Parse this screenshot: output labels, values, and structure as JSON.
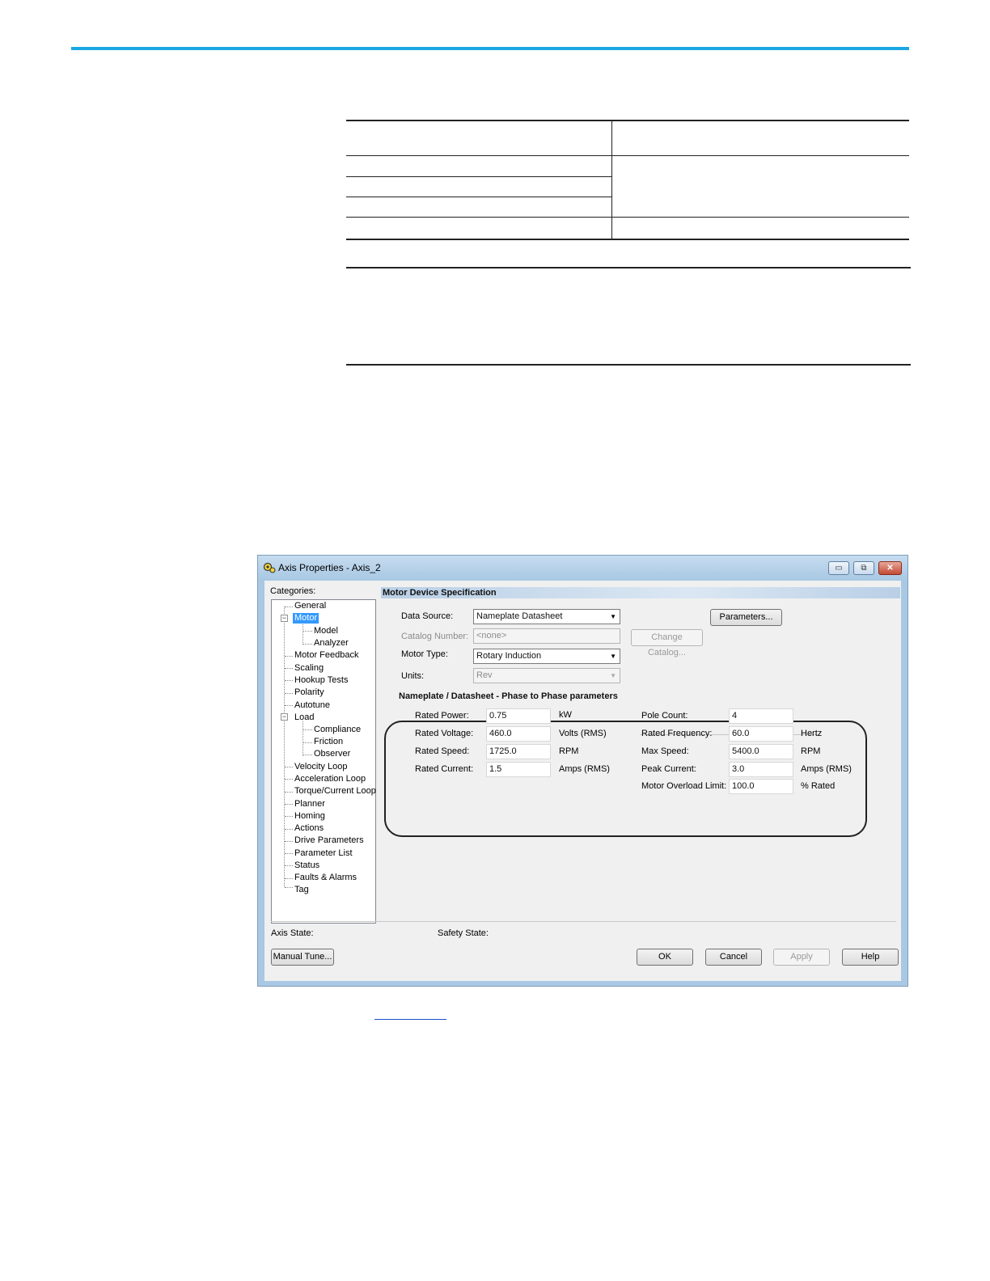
{
  "dialog": {
    "title": "Axis Properties - Axis_2",
    "window_buttons": {
      "minimize": "▭",
      "restore": "⧉",
      "close": "✕"
    },
    "categories_label": "Categories:",
    "tree": [
      "General",
      "Motor",
      "Model",
      "Analyzer",
      "Motor Feedback",
      "Scaling",
      "Hookup Tests",
      "Polarity",
      "Autotune",
      "Load",
      "Compliance",
      "Friction",
      "Observer",
      "Velocity Loop",
      "Acceleration Loop",
      "Torque/Current Loop",
      "Planner",
      "Homing",
      "Actions",
      "Drive Parameters",
      "Parameter List",
      "Status",
      "Faults & Alarms",
      "Tag"
    ],
    "section_title": "Motor Device Specification",
    "data_source_label": "Data Source:",
    "data_source_value": "Nameplate Datasheet",
    "parameters_button": "Parameters...",
    "catalog_number_label": "Catalog Number:",
    "catalog_number_value": "<none>",
    "change_catalog_button": "Change Catalog...",
    "motor_type_label": "Motor Type:",
    "motor_type_value": "Rotary Induction",
    "units_label": "Units:",
    "units_value": "Rev",
    "nameplate_title": "Nameplate / Datasheet - Phase to Phase parameters",
    "rated_power_label": "Rated Power:",
    "rated_power_value": "0.75",
    "rated_power_unit": "kW",
    "rated_voltage_label": "Rated Voltage:",
    "rated_voltage_value": "460.0",
    "rated_voltage_unit": "Volts (RMS)",
    "rated_speed_label": "Rated Speed:",
    "rated_speed_value": "1725.0",
    "rated_speed_unit": "RPM",
    "rated_current_label": "Rated Current:",
    "rated_current_value": "1.5",
    "rated_current_unit": "Amps (RMS)",
    "pole_count_label": "Pole Count:",
    "pole_count_value": "4",
    "rated_frequency_label": "Rated Frequency:",
    "rated_frequency_value": "60.0",
    "rated_frequency_unit": "Hertz",
    "max_speed_label": "Max Speed:",
    "max_speed_value": "5400.0",
    "max_speed_unit": "RPM",
    "peak_current_label": "Peak Current:",
    "peak_current_value": "3.0",
    "peak_current_unit": "Amps (RMS)",
    "overload_label": "Motor Overload Limit:",
    "overload_value": "100.0",
    "overload_unit": "% Rated",
    "axis_state_label": "Axis State:",
    "safety_state_label": "Safety State:",
    "manual_tune_button": "Manual Tune...",
    "ok_button": "OK",
    "cancel_button": "Cancel",
    "apply_button": "Apply",
    "help_button": "Help"
  },
  "colors": {
    "accent_line": "#1ba7e1",
    "selection": "#3399ff"
  }
}
